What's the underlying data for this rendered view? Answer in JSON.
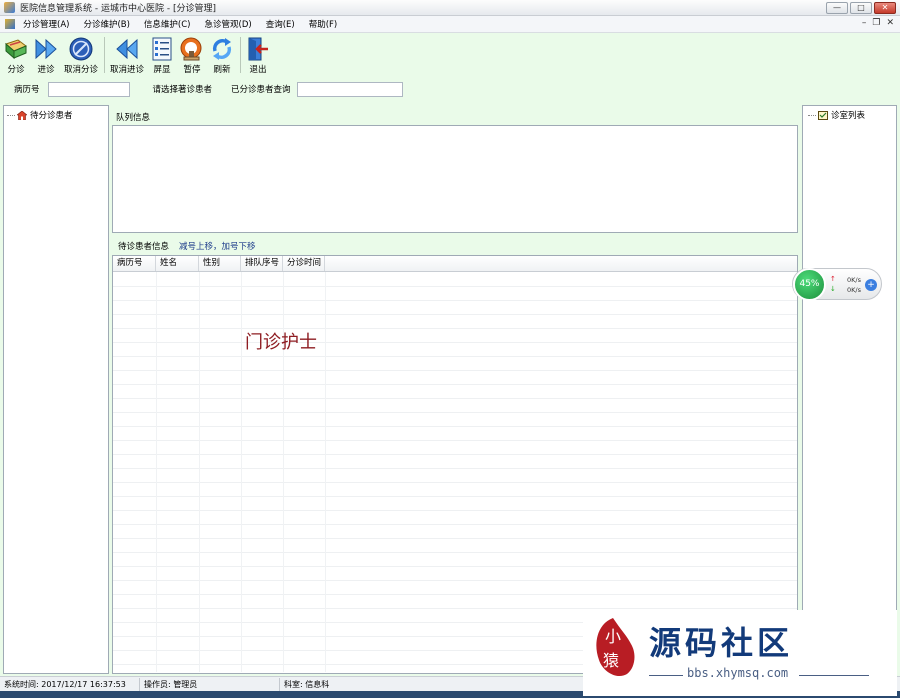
{
  "window": {
    "title": "医院信息管理系统   -   运城市中心医院 - [分诊管理]"
  },
  "menu": {
    "items": [
      "分诊管理(A)",
      "分诊维护(B)",
      "信息维护(C)",
      "急诊管观(D)",
      "查询(E)",
      "帮助(F)"
    ]
  },
  "toolbar": {
    "buttons": [
      {
        "label": "分诊",
        "icon": "triage-book-icon"
      },
      {
        "label": "进诊",
        "icon": "fast-forward-icon"
      },
      {
        "label": "取消分诊",
        "icon": "cancel-circle-icon"
      },
      {
        "label": "取消进诊",
        "icon": "rewind-icon"
      },
      {
        "label": "屏显",
        "icon": "screen-list-icon"
      },
      {
        "label": "暂停",
        "icon": "pause-stamp-icon"
      },
      {
        "label": "刷新",
        "icon": "refresh-icon"
      },
      {
        "label": "退出",
        "icon": "exit-door-icon"
      }
    ]
  },
  "search": {
    "record_label": "病历号",
    "record_value": "",
    "select_hint": "请选择著诊患者",
    "query_label": "已分诊患者查询",
    "query_value": ""
  },
  "left_panel": {
    "node": "待分诊患者"
  },
  "right_panel": {
    "node": "诊室列表"
  },
  "queue": {
    "label": "队列信息"
  },
  "waiting": {
    "label": "待诊患者信息",
    "hint": "减号上移，加号下移"
  },
  "grid": {
    "columns": [
      "病历号",
      "姓名",
      "性别",
      "排队序号",
      "分诊时间"
    ],
    "rows": []
  },
  "role_text": "门诊护士",
  "netmon": {
    "percent": "45%",
    "up": "0K/s",
    "down": "0K/s"
  },
  "status": {
    "time": "系统时间: 2017/12/17 16:37:53",
    "operator": "操作员: 管理员",
    "department": "科室: 信息科"
  },
  "watermark": {
    "seal_text": "小猿",
    "brand": "源码社区",
    "url": "bbs.xhymsq.com"
  },
  "colors": {
    "background": "#eafbe9",
    "accent_text": "#8e1c22",
    "hint_text": "#1b3a8a"
  }
}
